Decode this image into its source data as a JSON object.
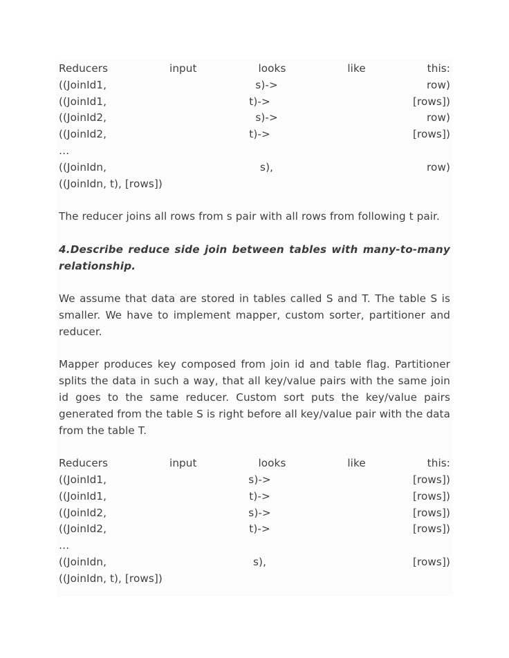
{
  "document": {
    "blocks": [
      {
        "id": "reducer-input-block-1",
        "type": "justified-lines",
        "lines": [
          {
            "id": "header",
            "style": "justified",
            "text": "Reducers input looks like this:"
          },
          {
            "id": "row1",
            "style": "justified",
            "text": "((JoinId1, s)-> row)"
          },
          {
            "id": "row2",
            "style": "justified",
            "text": "((JoinId1, t)-> [rows])"
          },
          {
            "id": "row3",
            "style": "justified",
            "text": "((JoinId2, s)-> row)"
          },
          {
            "id": "row4",
            "style": "justified",
            "text": "((JoinId2, t)-> [rows])"
          },
          {
            "id": "ellipsis",
            "style": "ellipsis",
            "text": "…"
          },
          {
            "id": "rown-s",
            "style": "justified",
            "text": "((JoinIdn, s), row)"
          },
          {
            "id": "rown-t",
            "style": "plain",
            "text": "((JoinIdn, t), [rows])"
          }
        ]
      },
      {
        "id": "reducer-join-note",
        "type": "paragraph",
        "justified": false,
        "text": "The reducer joins all rows from s pair with all rows from following t pair."
      },
      {
        "id": "section-heading-4",
        "type": "heading",
        "text": "4.Describe reduce side join between tables with many-to-many relationship."
      },
      {
        "id": "assumptions-paragraph",
        "type": "paragraph",
        "justified": true,
        "text": "We assume that data are stored in tables called S and T. The table S is smaller. We have to implement mapper, custom sorter, partitioner and reducer."
      },
      {
        "id": "mapper-paragraph",
        "type": "paragraph",
        "justified": true,
        "text": "Mapper produces key composed from join id and table flag. Partitioner splits the data in such a way, that all key/value pairs with the same join id goes to the same reducer. Custom sort puts the key/value pairs generated from the table S is right before all key/value pair with the data from the table T."
      },
      {
        "id": "reducer-input-block-2",
        "type": "justified-lines",
        "lines": [
          {
            "id": "header",
            "style": "justified",
            "text": "Reducers input looks like this:"
          },
          {
            "id": "row1",
            "style": "justified",
            "text": "((JoinId1, s)-> [rows])"
          },
          {
            "id": "row2",
            "style": "justified",
            "text": "((JoinId1, t)-> [rows])"
          },
          {
            "id": "row3",
            "style": "justified",
            "text": "((JoinId2, s)-> [rows])"
          },
          {
            "id": "row4",
            "style": "justified",
            "text": "((JoinId2, t)-> [rows])"
          },
          {
            "id": "ellipsis",
            "style": "ellipsis",
            "text": "…"
          },
          {
            "id": "rown-s",
            "style": "justified",
            "text": "((JoinIdn, s), [rows])"
          },
          {
            "id": "rown-t",
            "style": "plain",
            "text": "((JoinIdn, t), [rows])"
          }
        ]
      }
    ]
  },
  "colors": {
    "page_background": "#ffffff",
    "content_background": "#fcfcfc",
    "body_text": "#3f3f3f",
    "heading_text": "#3a3a3a"
  }
}
